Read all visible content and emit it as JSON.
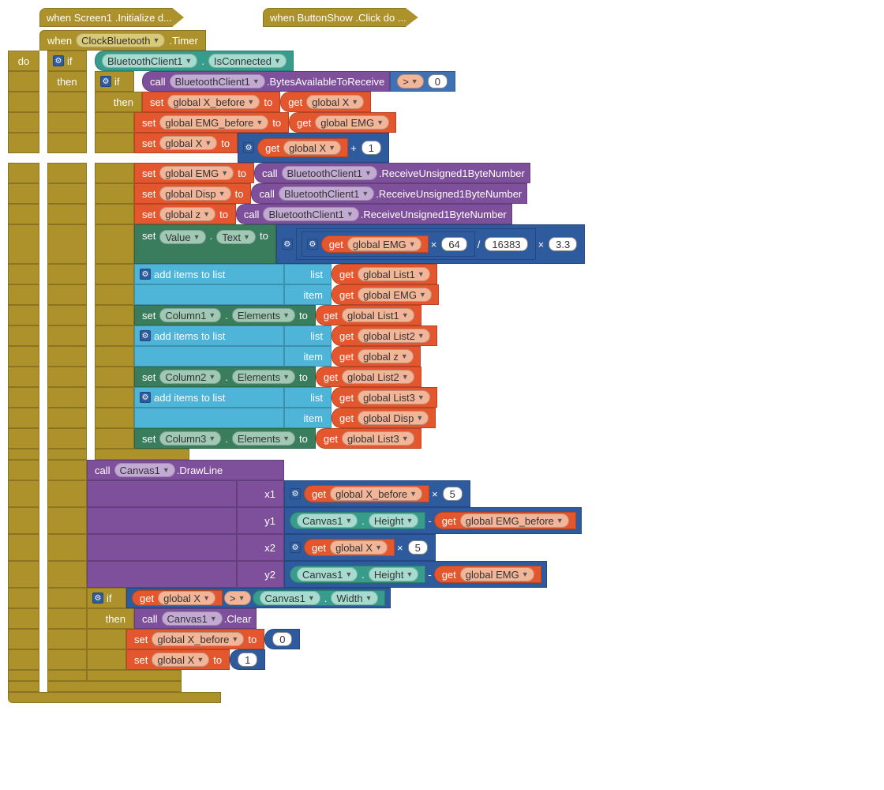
{
  "collapsed1": "when  Screen1 .Initialize d...",
  "collapsed2": "when  ButtonShow .Click do ...",
  "when_clock": {
    "when": "when",
    "clock": "ClockBluetooth",
    "timer": ".Timer"
  },
  "do": "do",
  "if": "if",
  "then": "then",
  "call": "call",
  "set": "set",
  "get": "get",
  "to": "to",
  "bt1": "BluetoothClient1",
  "isconn": "IsConnected",
  "bytesavail": ".BytesAvailableToReceive",
  "gt": ">",
  "zero": "0",
  "globals": {
    "X_before": "global X_before",
    "X": "global X",
    "EMG_before": "global EMG_before",
    "EMG": "global EMG",
    "Disp": "global Disp",
    "z": "global z",
    "List1": "global List1",
    "List2": "global List2",
    "List3": "global List3"
  },
  "plus": "+",
  "one": "1",
  "five": "5",
  "recv": ".ReceiveUnsigned1ByteNumber",
  "value": "Value",
  "text": "Text",
  "mul": "×",
  "n64": "64",
  "div": "/",
  "n16383": "16383",
  "n33": "3.3",
  "additems": "add items to list",
  "list": "list",
  "item": "item",
  "column1": "Column1",
  "column2": "Column2",
  "column3": "Column3",
  "elements": "Elements",
  "canvas": "Canvas1",
  "drawline": ".DrawLine",
  "x1": "x1",
  "y1": "y1",
  "x2": "x2",
  "y2": "y2",
  "height": "Height",
  "minus": "-",
  "width": "Width",
  "clear": ".Clear"
}
